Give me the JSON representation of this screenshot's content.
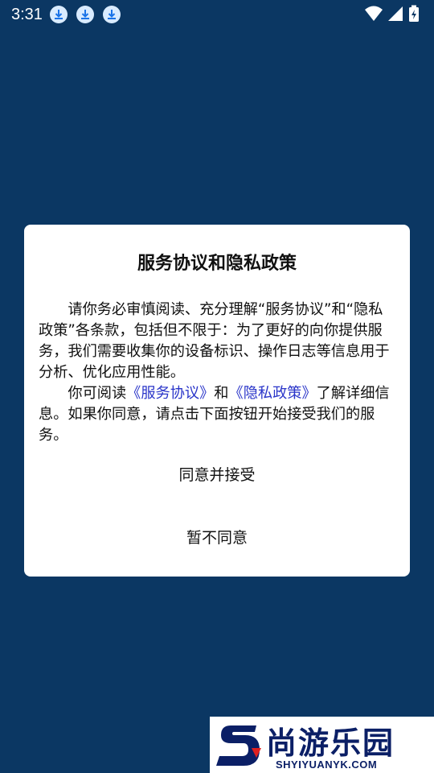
{
  "status_bar": {
    "time": "3:31",
    "notification_icons": [
      "download-icon",
      "download-icon",
      "download-icon"
    ],
    "system_icons": [
      "wifi-icon",
      "signal-icon",
      "battery-charging-icon"
    ]
  },
  "dialog": {
    "title": "服务协议和隐私政策",
    "paragraph1": "请你务必审慎阅读、充分理解“服务协议”和“隐私政策”各条款，包括但不限于：为了更好的向你提供服务，我们需要收集你的设备标识、操作日志等信息用于分析、优化应用性能。",
    "paragraph2_prefix": "你可阅读",
    "service_link": "《服务协议》",
    "paragraph2_and": "和",
    "privacy_link": "《隐私政策》",
    "paragraph2_suffix": "了解详细信息。如果你同意，请点击下面按钮开始接受我们的服务。",
    "accept_label": "同意并接受",
    "decline_label": "暂不同意"
  },
  "watermark": {
    "name": "尚游乐园",
    "domain": "SHYIYUANYK.COM"
  },
  "colors": {
    "background": "#0b3763",
    "link": "#2a35c9",
    "dialog": "#ffffff"
  }
}
